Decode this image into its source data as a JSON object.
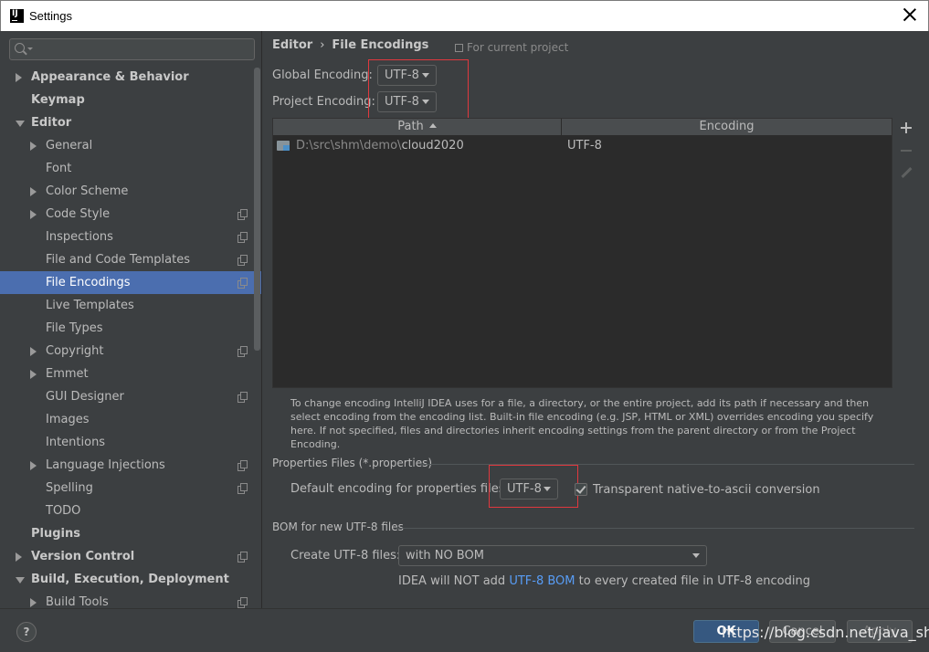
{
  "window": {
    "title": "Settings",
    "icon_text": "IJ"
  },
  "sidebar": {
    "search_placeholder": "",
    "items": [
      {
        "label": "Appearance & Behavior",
        "level": 0,
        "arrow": "right",
        "copy": false
      },
      {
        "label": "Keymap",
        "level": 0,
        "arrow": "none",
        "copy": false
      },
      {
        "label": "Editor",
        "level": 0,
        "arrow": "down",
        "copy": false
      },
      {
        "label": "General",
        "level": 1,
        "arrow": "right",
        "copy": false
      },
      {
        "label": "Font",
        "level": 1,
        "arrow": "none",
        "copy": false
      },
      {
        "label": "Color Scheme",
        "level": 1,
        "arrow": "right",
        "copy": false
      },
      {
        "label": "Code Style",
        "level": 1,
        "arrow": "right",
        "copy": true
      },
      {
        "label": "Inspections",
        "level": 1,
        "arrow": "none",
        "copy": true
      },
      {
        "label": "File and Code Templates",
        "level": 1,
        "arrow": "none",
        "copy": true
      },
      {
        "label": "File Encodings",
        "level": 1,
        "arrow": "none",
        "copy": true,
        "selected": true
      },
      {
        "label": "Live Templates",
        "level": 1,
        "arrow": "none",
        "copy": false
      },
      {
        "label": "File Types",
        "level": 1,
        "arrow": "none",
        "copy": false
      },
      {
        "label": "Copyright",
        "level": 1,
        "arrow": "right",
        "copy": true
      },
      {
        "label": "Emmet",
        "level": 1,
        "arrow": "right",
        "copy": false
      },
      {
        "label": "GUI Designer",
        "level": 1,
        "arrow": "none",
        "copy": true
      },
      {
        "label": "Images",
        "level": 1,
        "arrow": "none",
        "copy": false
      },
      {
        "label": "Intentions",
        "level": 1,
        "arrow": "none",
        "copy": false
      },
      {
        "label": "Language Injections",
        "level": 1,
        "arrow": "right",
        "copy": true
      },
      {
        "label": "Spelling",
        "level": 1,
        "arrow": "none",
        "copy": true
      },
      {
        "label": "TODO",
        "level": 1,
        "arrow": "none",
        "copy": false
      },
      {
        "label": "Plugins",
        "level": 0,
        "arrow": "none",
        "copy": false
      },
      {
        "label": "Version Control",
        "level": 0,
        "arrow": "right",
        "copy": true
      },
      {
        "label": "Build, Execution, Deployment",
        "level": 0,
        "arrow": "down",
        "copy": false
      },
      {
        "label": "Build Tools",
        "level": 1,
        "arrow": "right",
        "copy": true
      }
    ]
  },
  "breadcrumb": {
    "parent": "Editor",
    "separator": "›",
    "current": "File Encodings",
    "scope": "For current project"
  },
  "global_encoding": {
    "label": "Global Encoding:",
    "value": "UTF-8"
  },
  "project_encoding": {
    "label": "Project Encoding:",
    "value": "UTF-8"
  },
  "table": {
    "columns": [
      "Path",
      "Encoding"
    ],
    "rows": [
      {
        "path_prefix": "D:\\src\\shm\\demo\\",
        "path_leaf": "cloud2020",
        "encoding": "UTF-8"
      }
    ]
  },
  "info_text": "To change encoding IntelliJ IDEA uses for a file, a directory, or the entire project, add its path if necessary and then select encoding from the encoding list. Built-in file encoding (e.g. JSP, HTML or XML) overrides encoding you specify here. If not specified, files and directories inherit encoding settings from the parent directory or from the Project Encoding.",
  "properties_section": {
    "title": "Properties Files (*.properties)",
    "default_label": "Default encoding for properties files:",
    "default_value": "UTF-8",
    "transparent_label": "Transparent native-to-ascii conversion",
    "transparent_checked": true
  },
  "bom_section": {
    "title": "BOM for new UTF-8 files",
    "create_label": "Create UTF-8 files:",
    "create_value": "with NO BOM",
    "note_prefix": "IDEA will NOT add ",
    "note_link": "UTF-8 BOM",
    "note_suffix": " to every created file in UTF-8 encoding"
  },
  "buttons": {
    "help": "?",
    "ok": "OK",
    "cancel": "Cancel",
    "apply": "Apply"
  },
  "watermark": "https://blog.csdn.net/java_shm",
  "colors": {
    "accent": "#4b6eaf",
    "highlight_box": "#e0383e",
    "link": "#589df6",
    "background": "#3c3f41"
  }
}
